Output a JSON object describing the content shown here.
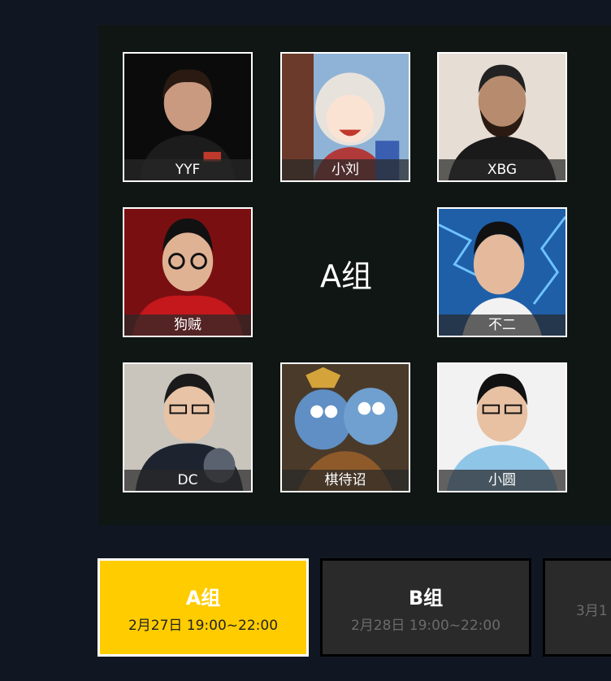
{
  "group_panel": {
    "center_label": "A组",
    "players": [
      {
        "name": "YYF"
      },
      {
        "name": "小刘"
      },
      {
        "name": "XBG"
      },
      {
        "name": "狗贼"
      },
      {
        "name": "不二"
      },
      {
        "name": "DC"
      },
      {
        "name": "棋待诏"
      },
      {
        "name": "小圆"
      }
    ]
  },
  "tabs": [
    {
      "title": "A组",
      "time": "2月27日 19:00~22:00",
      "state": "active"
    },
    {
      "title": "B组",
      "time": "2月28日 19:00~22:00",
      "state": "inactive"
    },
    {
      "title": "",
      "time": "3月1",
      "state": "inactive"
    }
  ],
  "colors": {
    "page_background": "#111722",
    "panel_background": "#0f1613",
    "active_tab": "#ffcc00",
    "inactive_tab": "#2a2a2a"
  }
}
